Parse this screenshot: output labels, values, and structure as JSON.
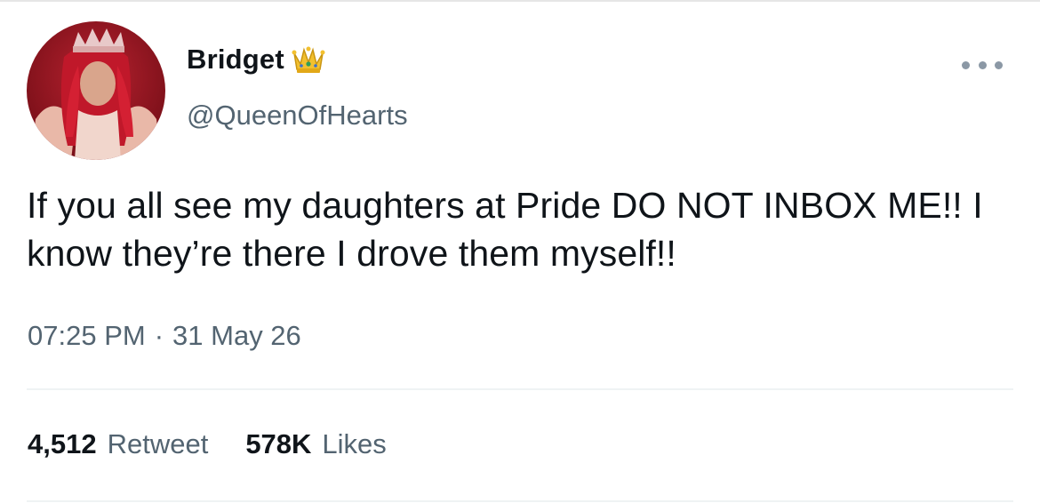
{
  "tweet": {
    "author": {
      "display_name": "Bridget",
      "badge_icon": "crown-icon",
      "handle": "@QueenOfHearts",
      "avatar_icon": "avatar-image"
    },
    "more_icon": "more-options-icon",
    "text": "If you all see my daughters at Pride DO NOT INBOX ME!! I know they’re there I drove them myself!!",
    "time": "07:25 PM",
    "separator": "·",
    "date": "31 May 26",
    "stats": {
      "retweets_count": "4,512",
      "retweets_label": "Retweet",
      "likes_count": "578K",
      "likes_label": "Likes"
    }
  },
  "colors": {
    "text_primary": "#0f1419",
    "text_secondary": "#536471",
    "divider": "#eff3f4"
  }
}
